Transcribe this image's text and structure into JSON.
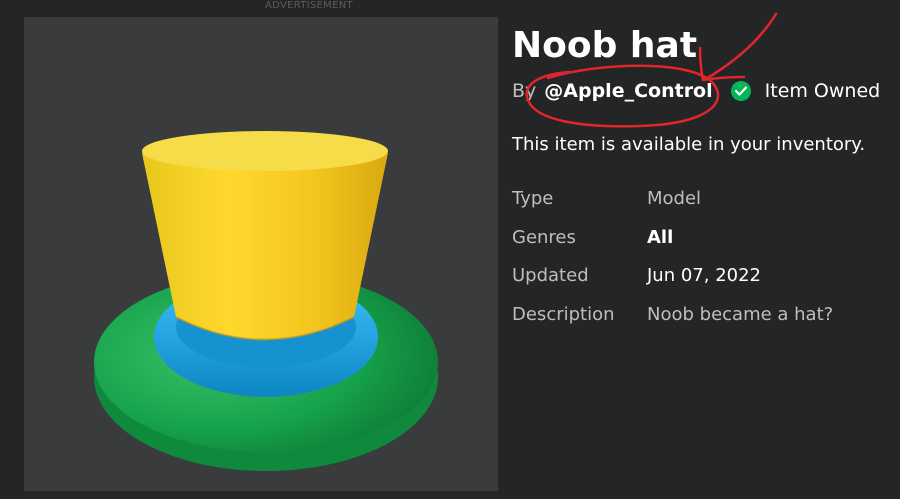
{
  "ad_label": "ADVERTISEMENT",
  "item": {
    "title": "Noob hat",
    "by_prefix": "By",
    "creator": "@Apple_Control",
    "owned_label": "Item Owned",
    "availability": "This item is available in your inventory."
  },
  "info": {
    "type_label": "Type",
    "type_value": "Model",
    "genres_label": "Genres",
    "genres_value": "All",
    "updated_label": "Updated",
    "updated_value": "Jun 07, 2022",
    "description_label": "Description",
    "description_value": "Noob became a hat?"
  },
  "colors": {
    "page_bg": "#232527",
    "preview_bg": "#393b3d",
    "hat_top": "#f5cd2f",
    "hat_ring": "#1fa9e8",
    "hat_brim": "#16a34b",
    "owned_check": "#02b757",
    "annotation": "#e0262b"
  },
  "icons": {
    "owned": "check-circle-icon"
  }
}
